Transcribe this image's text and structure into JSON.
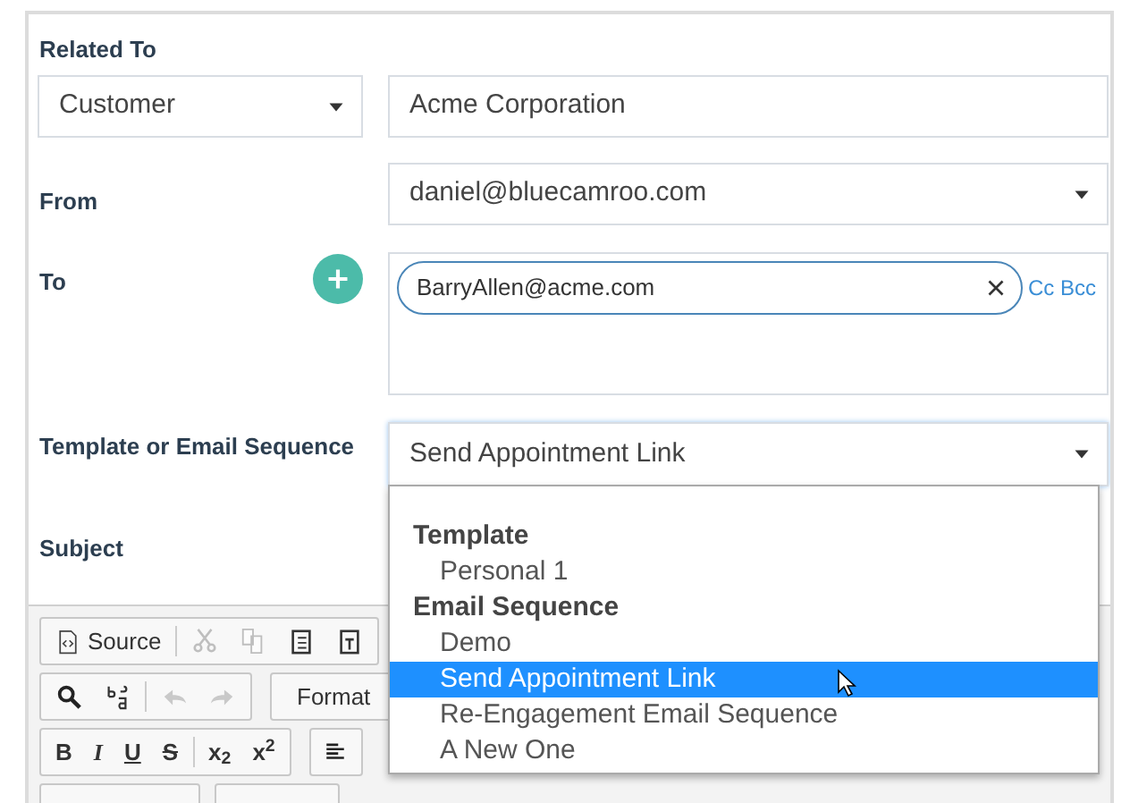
{
  "related_to": {
    "label": "Related To",
    "type_select": {
      "value": "Customer"
    },
    "company_field": {
      "value": "Acme Corporation"
    }
  },
  "from": {
    "label": "From",
    "select": {
      "value": "daniel@bluecamroo.com"
    }
  },
  "to": {
    "label": "To",
    "recipients": [
      "BarryAllen@acme.com"
    ],
    "cc_bcc": "Cc Bcc"
  },
  "template": {
    "label": "Template or Email Sequence",
    "select": {
      "value": "Send Appointment Link",
      "expanded": true
    },
    "groups": [
      {
        "header": "Template",
        "options": [
          {
            "label": "Personal 1",
            "selected": false
          }
        ]
      },
      {
        "header": "Email Sequence",
        "options": [
          {
            "label": "Demo",
            "selected": false
          },
          {
            "label": "Send Appointment Link",
            "selected": true
          },
          {
            "label": "Re-Engagement Email Sequence",
            "selected": false
          },
          {
            "label": "A New One",
            "selected": false
          }
        ]
      }
    ]
  },
  "subject": {
    "label": "Subject"
  },
  "toolbar": [
    [
      [
        {
          "kind": "source",
          "label": "Source",
          "disabled": false
        }
      ],
      [
        {
          "kind": "cut",
          "disabled": true
        },
        {
          "kind": "copy",
          "disabled": true
        },
        {
          "kind": "paste",
          "disabled": false
        },
        {
          "kind": "paste-text",
          "disabled": false
        }
      ]
    ],
    [
      [
        {
          "kind": "find",
          "disabled": false
        },
        {
          "kind": "replace",
          "disabled": false
        }
      ],
      [
        {
          "kind": "undo",
          "disabled": true
        },
        {
          "kind": "redo",
          "disabled": true
        }
      ]
    ],
    [
      [
        {
          "kind": "text",
          "label": "B",
          "disabled": false
        },
        {
          "kind": "text",
          "label": "I",
          "disabled": false
        },
        {
          "kind": "text",
          "label": "U",
          "disabled": false
        },
        {
          "kind": "text",
          "label": "S",
          "disabled": false
        }
      ],
      [
        {
          "kind": "text",
          "label": "x$_{2}$",
          "disabled": false
        },
        {
          "kind": "text",
          "label": "x$^{2}$",
          "disabled": false
        }
      ]
    ]
  ],
  "format_select": {
    "value": "Format"
  }
}
